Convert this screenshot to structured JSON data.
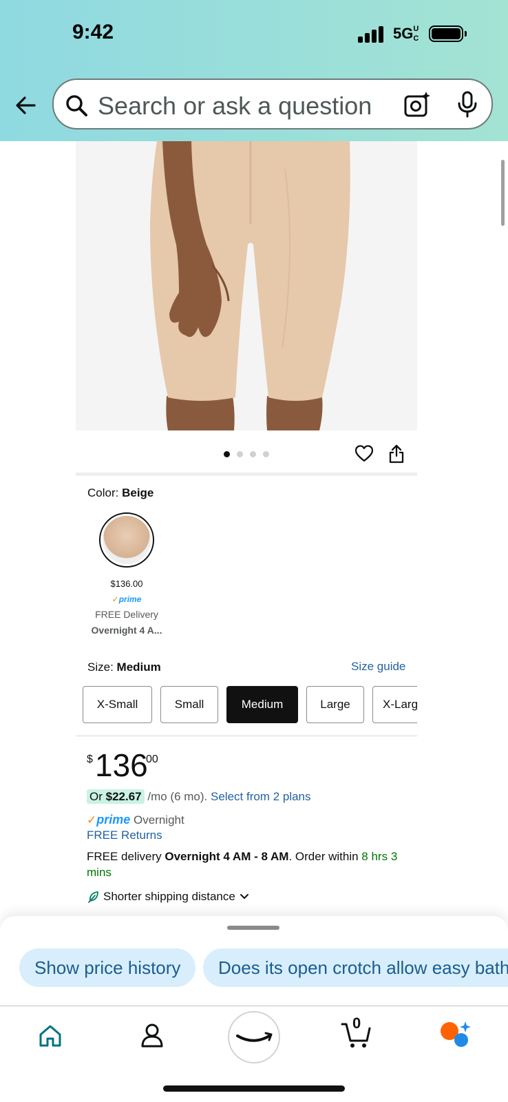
{
  "status": {
    "time": "9:42",
    "network": "5G UC"
  },
  "search": {
    "placeholder": "Search or ask a question"
  },
  "colors": {
    "link": "#2162a1",
    "prime": "#1a98ff",
    "green": "#007600",
    "chip_bg": "#d8eefc",
    "header_gradient": [
      "#8fd9e1",
      "#a3e3d4"
    ]
  },
  "gallery": {
    "image_count": 4,
    "active_index": 0
  },
  "color_selector": {
    "label": "Color:",
    "value": "Beige",
    "swatch": {
      "price": "$136.00",
      "prime": "prime",
      "delivery": "FREE Delivery",
      "speed": "Overnight 4 A..."
    }
  },
  "size_selector": {
    "label": "Size:",
    "value": "Medium",
    "guide_link": "Size guide",
    "options": [
      "X-Small",
      "Small",
      "Medium",
      "Large",
      "X-Large"
    ],
    "selected": "Medium"
  },
  "pricing": {
    "currency": "$",
    "whole": "136",
    "fraction": "00",
    "monthly_prefix": "Or",
    "monthly_amount": "$22.67",
    "monthly_suffix": "/mo (6 mo).",
    "plans_link": "Select from 2 plans"
  },
  "delivery": {
    "prime_label": "prime",
    "prime_speed": "Overnight",
    "returns": "FREE Returns",
    "free_delivery_prefix": "FREE delivery",
    "window": "Overnight 4 AM - 8 AM",
    "order_within_prefix": ". Order within",
    "countdown": "8 hrs 3 mins",
    "shorter_shipping": "Shorter shipping distance"
  },
  "rufus_chips": [
    "Show price history",
    "Does its open crotch allow easy bathroom use?"
  ],
  "nav": {
    "items": [
      "home-icon",
      "account-icon",
      "amazon-smile-icon",
      "cart-icon",
      "rufus-icon"
    ],
    "cart_count": "0"
  }
}
